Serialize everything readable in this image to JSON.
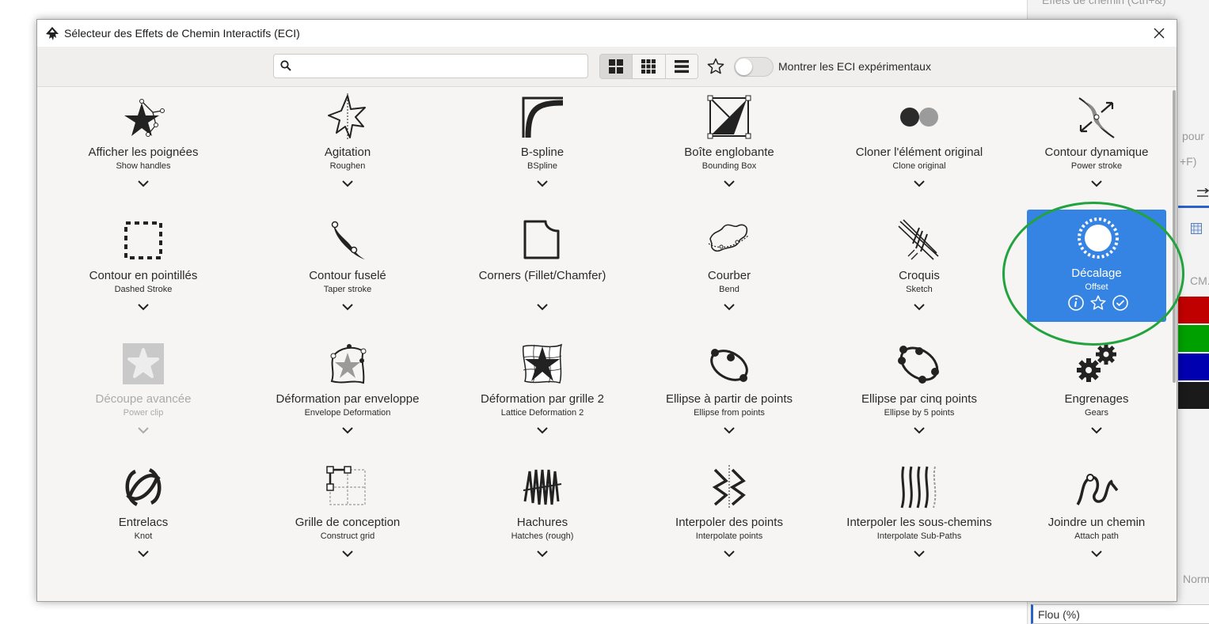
{
  "background_app": {
    "texts": [
      "Effets de chemin (Ctrl+&)",
      "pour",
      "+F)",
      "CM.",
      "Norm"
    ],
    "flou_label": "Flou (%)",
    "swatch_colors": [
      "#c00000",
      "#00a000",
      "#0000b0",
      "#1a1a1a"
    ]
  },
  "dialog": {
    "title": "Sélecteur des Effets de Chemin Interactifs (ECI)",
    "title_icon": "inkscape-logo-icon",
    "close_icon": "close-icon"
  },
  "toolbar": {
    "search_value": "",
    "view_modes": [
      "large-grid-icon",
      "small-grid-icon",
      "list-icon"
    ],
    "active_view": 0,
    "favorites_icon": "star-outline-icon",
    "experimental_label": "Montrer les ECI expérimentaux",
    "experimental_on": false
  },
  "accent_color": "#3584e4",
  "annotation_color": "#22a33e",
  "effects": [
    {
      "name": "Afficher les poignées",
      "sub": "Show handles",
      "icon": "show-handles"
    },
    {
      "name": "Agitation",
      "sub": "Roughen",
      "icon": "roughen"
    },
    {
      "name": "B-spline",
      "sub": "BSpline",
      "icon": "bspline"
    },
    {
      "name": "Boîte englobante",
      "sub": "Bounding Box",
      "icon": "bounding-box"
    },
    {
      "name": "Cloner l'élément original",
      "sub": "Clone original",
      "icon": "clone-original"
    },
    {
      "name": "Contour dynamique",
      "sub": "Power stroke",
      "icon": "power-stroke"
    },
    {
      "name": "Contour en pointillés",
      "sub": "Dashed Stroke",
      "icon": "dashed-stroke"
    },
    {
      "name": "Contour fuselé",
      "sub": "Taper stroke",
      "icon": "taper-stroke"
    },
    {
      "name": "Corners (Fillet/Chamfer)",
      "sub": "",
      "icon": "corners"
    },
    {
      "name": "Courber",
      "sub": "Bend",
      "icon": "bend"
    },
    {
      "name": "Croquis",
      "sub": "Sketch",
      "icon": "sketch"
    },
    {
      "name": "Décalage",
      "sub": "Offset",
      "icon": "offset",
      "selected": true
    },
    {
      "name": "Découpe avancée",
      "sub": "Power clip",
      "icon": "power-clip",
      "disabled": true
    },
    {
      "name": "Déformation par enveloppe",
      "sub": "Envelope Deformation",
      "icon": "envelope"
    },
    {
      "name": "Déformation par grille 2",
      "sub": "Lattice Deformation 2",
      "icon": "lattice"
    },
    {
      "name": "Ellipse à partir de points",
      "sub": "Ellipse from points",
      "icon": "ellipse-points"
    },
    {
      "name": "Ellipse par cinq points",
      "sub": "Ellipse by 5 points",
      "icon": "ellipse-five"
    },
    {
      "name": "Engrenages",
      "sub": "Gears",
      "icon": "gears"
    },
    {
      "name": "Entrelacs",
      "sub": "Knot",
      "icon": "knot"
    },
    {
      "name": "Grille de conception",
      "sub": "Construct grid",
      "icon": "construct-grid"
    },
    {
      "name": "Hachures",
      "sub": "Hatches (rough)",
      "icon": "hatches"
    },
    {
      "name": "Interpoler des points",
      "sub": "Interpolate points",
      "icon": "interpolate-points"
    },
    {
      "name": "Interpoler les sous-chemins",
      "sub": "Interpolate Sub-Paths",
      "icon": "interpolate-subpaths"
    },
    {
      "name": "Joindre un chemin",
      "sub": "Attach path",
      "icon": "attach-path"
    }
  ],
  "selected_actions": [
    "info-icon",
    "star-icon",
    "check-circle-icon"
  ]
}
